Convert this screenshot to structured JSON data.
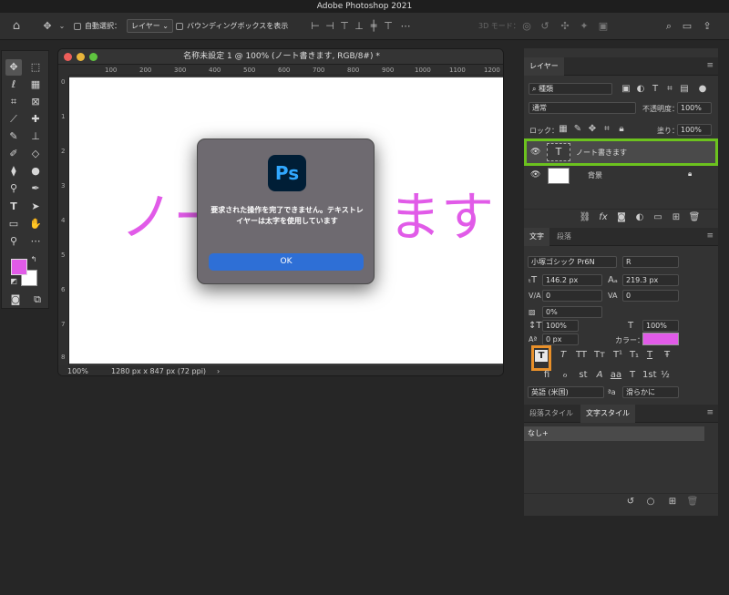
{
  "app": {
    "title": "Adobe Photoshop 2021"
  },
  "options": {
    "auto_select_label": "自動選択：",
    "auto_select_value": "レイヤー",
    "bbox_label": "バウンディングボックスを表示",
    "mode_3d_label": "3D モード："
  },
  "document": {
    "title": "名称未設定 1 @ 100% (ノート書きます, RGB/8#) *",
    "canvas_text_left": "ノー",
    "canvas_text_right": "ます",
    "text_color": "#e15be8",
    "zoom": "100%",
    "size": "1280 px x 847 px (72 ppi)",
    "hruler": [
      "100",
      "200",
      "300",
      "400",
      "500",
      "600",
      "700",
      "800",
      "900",
      "1000",
      "1100",
      "1200"
    ],
    "vruler": [
      "0",
      "1",
      "2",
      "3",
      "4",
      "5",
      "6",
      "7",
      "8"
    ]
  },
  "dialog": {
    "logo": "Ps",
    "message": "要求された操作を完了できません。テキストレイヤーは太字を使用しています",
    "ok_label": "OK"
  },
  "layers_panel": {
    "tab": "レイヤー",
    "kind_filter": "種類",
    "blend_mode": "通常",
    "opacity_label": "不透明度：",
    "opacity_value": "100%",
    "lock_label": "ロック：",
    "fill_label": "塗り：",
    "fill_value": "100%",
    "layers": [
      {
        "name": "ノート書きます",
        "type_icon": "T"
      },
      {
        "name": "背景"
      }
    ]
  },
  "character_panel": {
    "tabs": [
      "文字",
      "段落"
    ],
    "font_family": "小塚ゴシック Pr6N",
    "font_style": "R",
    "font_size": "146.2 px",
    "leading": "219.3 px",
    "kerning": "0",
    "tracking": "0",
    "tsume": "0%",
    "vertical_scale": "100%",
    "horizontal_scale": "100%",
    "baseline_shift": "0 px",
    "color_label": "カラー：",
    "color_value": "#e15be8",
    "style_buttons": [
      "T",
      "T",
      "TT",
      "Tт",
      "T¹",
      "T₁",
      "T",
      "Ŧ"
    ],
    "opentype_buttons": [
      "fi",
      "ℴ",
      "st",
      "A",
      "aa",
      "T",
      "1st",
      "½"
    ],
    "language": "英語 (米国)",
    "aa_label": "ªa",
    "antialias": "滑らかに"
  },
  "styles_panel": {
    "tabs": [
      "段落スタイル",
      "文字スタイル"
    ],
    "items": [
      "なし+"
    ]
  },
  "colors": {
    "foreground": "#e15be8",
    "background": "#ffffff",
    "highlight_green": "#6cc21e",
    "highlight_orange": "#e8902a"
  }
}
